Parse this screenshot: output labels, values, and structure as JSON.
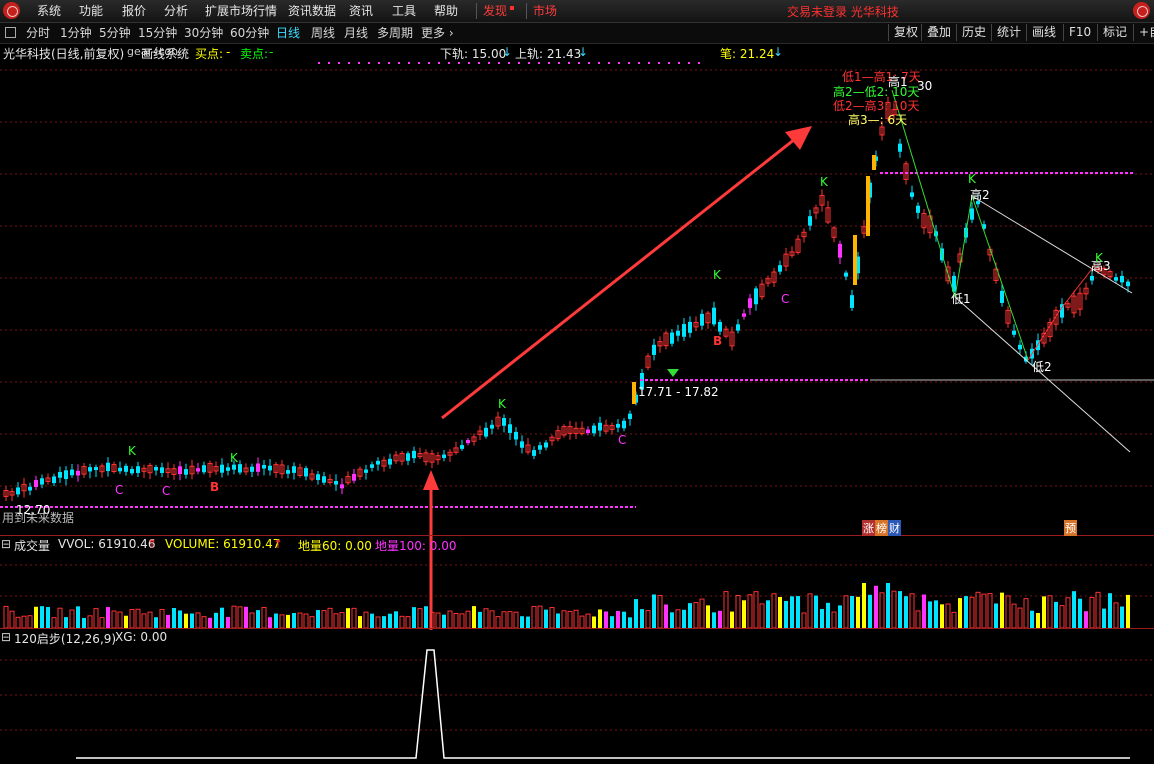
{
  "menu": {
    "items": [
      "系统",
      "功能",
      "报价",
      "分析",
      "扩展市场行情",
      "资讯数据",
      "资讯",
      "工具",
      "帮助"
    ],
    "discover": "发现",
    "market": "市场",
    "status_text": "交易未登录  光华科技"
  },
  "periods": {
    "items": [
      "分时",
      "1分钟",
      "5分钟",
      "15分钟",
      "30分钟",
      "60分钟",
      "日线",
      "周线",
      "月线",
      "多周期",
      "更多"
    ],
    "active": "日线",
    "more_arrow": "›"
  },
  "toolbar": {
    "items": [
      "复权",
      "叠加",
      "历史",
      "统计",
      "画线",
      "F10",
      "标记",
      "+自"
    ]
  },
  "chart_info": {
    "stock": "光华科技(日线,前复权)",
    "system_icon": "gear-icon",
    "system": "画线系统",
    "buy_label": "买点:",
    "buy_value": "-",
    "sell_label": "卖点:",
    "sell_value": "-",
    "lower_rail": "下轨: 15.00",
    "upper_rail": "上轨: 21.43",
    "stroke_label": "笔: 21.24"
  },
  "annotations": {
    "high_low_1": "低1—高1: 7天",
    "high_low_2": "高2—低2: 10天",
    "high_low_3": "低2—高3: 10天",
    "high_low_4": "高3—: 6天",
    "peak_high": "高1",
    "peak_value": "30",
    "price_range": "17.71 - 17.82",
    "low_price": "12.70",
    "no_data": "用到未来数据",
    "high2": "高2",
    "low1": "低1",
    "low2": "低2",
    "high3": "高3",
    "tag_zhang": "涨",
    "tag_bang": "榜",
    "tag_cai": "财",
    "tag_yu": "预",
    "mark_k": "K",
    "mark_c": "C",
    "mark_b": "B"
  },
  "volume_panel": {
    "title": "成交量",
    "vvol": "VVOL: 61910.46",
    "volume": "VOLUME: 61910.47",
    "diliang60": "地量60: 0.00",
    "diliang100": "地量100: 0.00"
  },
  "indicator_panel": {
    "title": "120启步(12,26,9)",
    "xg": "XG: 0.00"
  },
  "colors": {
    "up": "#ff3333",
    "down": "#00e5ff",
    "magenta": "#ff33ff",
    "yellow": "#ffff00",
    "grid": "#7a1515",
    "arrow": "#ff3a3a"
  },
  "chart_data": {
    "type": "candlestick",
    "yticks_shown": false,
    "series": [
      {
        "name": "下轨",
        "value": 15.0
      },
      {
        "name": "上轨",
        "value": 21.43
      },
      {
        "name": "笔",
        "value": 21.24
      }
    ],
    "low_marker": 12.7,
    "price_range": [
      17.71,
      17.82
    ]
  }
}
